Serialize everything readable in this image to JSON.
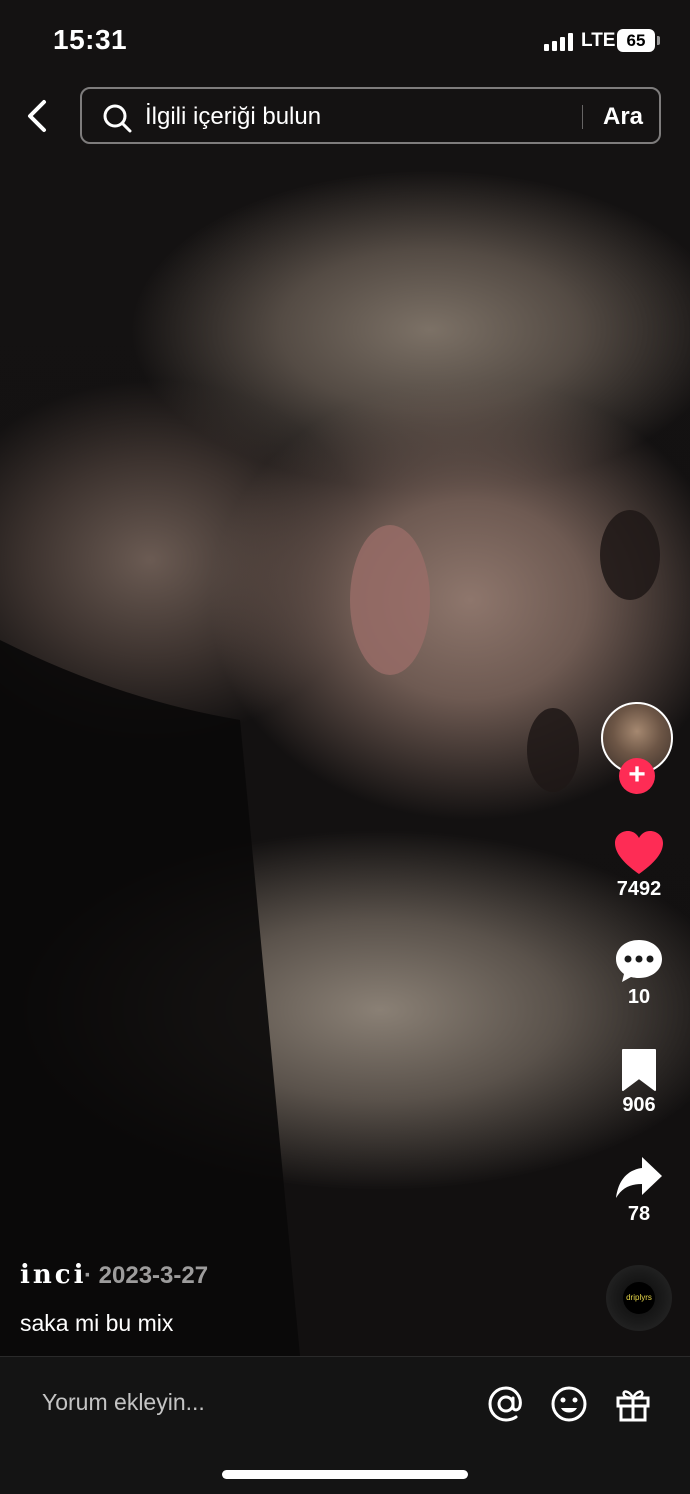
{
  "status": {
    "time": "15:31",
    "network": "LTE",
    "battery": "65"
  },
  "search": {
    "placeholder": "İlgili içeriği bulun",
    "button_label": "Ara"
  },
  "actions": {
    "likes": "7492",
    "comments": "10",
    "saves": "906",
    "shares": "78"
  },
  "post": {
    "author": "inci",
    "date": "· 2023-3-27",
    "caption": "saka mi bu mix"
  },
  "music": {
    "disc_label": "driplyrs"
  },
  "comment_bar": {
    "placeholder": "Yorum ekleyin..."
  },
  "colors": {
    "accent": "#fe2c55",
    "background": "#141414"
  },
  "icons": [
    "back-icon",
    "search-icon",
    "plus-icon",
    "heart-icon",
    "comment-icon",
    "bookmark-icon",
    "share-icon",
    "at-icon",
    "emoji-icon",
    "gift-icon"
  ]
}
